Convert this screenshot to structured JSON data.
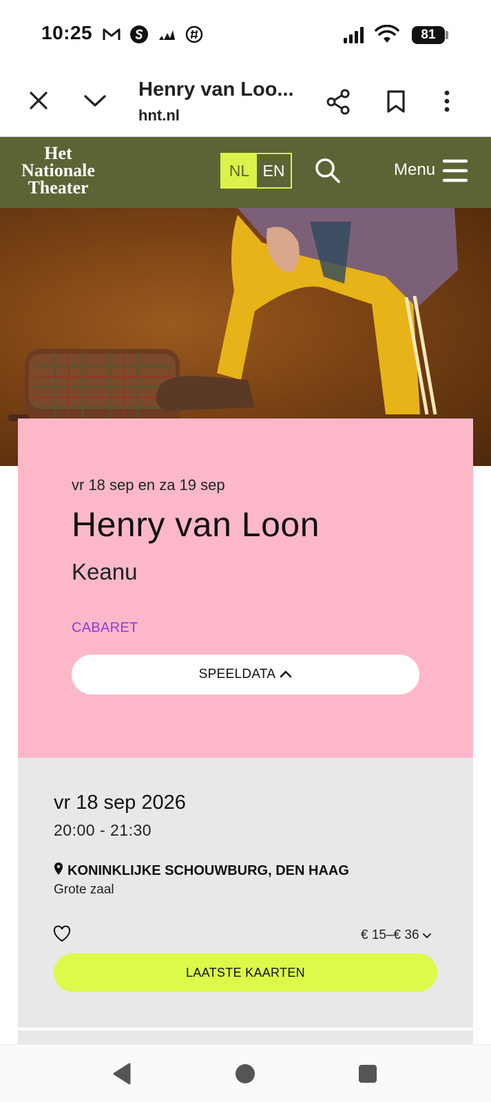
{
  "status_bar": {
    "time": "10:25",
    "battery": "81"
  },
  "browser": {
    "tab_title": "Henry van Loo...",
    "url": "hnt.nl"
  },
  "site": {
    "logo_lines": [
      "Het",
      "Nationale",
      "Theater"
    ],
    "lang_nl": "NL",
    "lang_en": "EN",
    "menu_label": "Menu"
  },
  "event": {
    "date_range": "vr 18 sep en za 19 sep",
    "title": "Henry van Loon",
    "subtitle": "Keanu",
    "genre": "CABARET",
    "speeldata_label": "SPEELDATA"
  },
  "performance": {
    "date": "vr 18 sep 2026",
    "time": "20:00 - 21:30",
    "venue": "KONINKLIJKE SCHOUWBURG, DEN HAAG",
    "hall": "Grote zaal",
    "price": "€ 15–€ 36",
    "buy_label": "LAATSTE KAARTEN"
  },
  "colors": {
    "header_green": "#5b6435",
    "lime": "#dcf24a",
    "card_pink": "#fcb8c9",
    "genre_purple": "#8d3bd6",
    "buy_lime": "#dcfa4a"
  }
}
